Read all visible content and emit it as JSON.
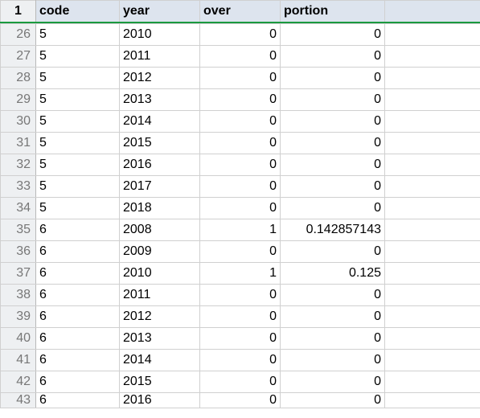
{
  "header_row_number": "1",
  "columns": {
    "code": "code",
    "year": "year",
    "over": "over",
    "portion": "portion",
    "blank": ""
  },
  "rows": [
    {
      "n": "26",
      "code": "5",
      "year": "2010",
      "over": "0",
      "portion": "0"
    },
    {
      "n": "27",
      "code": "5",
      "year": "2011",
      "over": "0",
      "portion": "0"
    },
    {
      "n": "28",
      "code": "5",
      "year": "2012",
      "over": "0",
      "portion": "0"
    },
    {
      "n": "29",
      "code": "5",
      "year": "2013",
      "over": "0",
      "portion": "0"
    },
    {
      "n": "30",
      "code": "5",
      "year": "2014",
      "over": "0",
      "portion": "0"
    },
    {
      "n": "31",
      "code": "5",
      "year": "2015",
      "over": "0",
      "portion": "0"
    },
    {
      "n": "32",
      "code": "5",
      "year": "2016",
      "over": "0",
      "portion": "0"
    },
    {
      "n": "33",
      "code": "5",
      "year": "2017",
      "over": "0",
      "portion": "0"
    },
    {
      "n": "34",
      "code": "5",
      "year": "2018",
      "over": "0",
      "portion": "0"
    },
    {
      "n": "35",
      "code": "6",
      "year": "2008",
      "over": "1",
      "portion": "0.142857143"
    },
    {
      "n": "36",
      "code": "6",
      "year": "2009",
      "over": "0",
      "portion": "0"
    },
    {
      "n": "37",
      "code": "6",
      "year": "2010",
      "over": "1",
      "portion": "0.125"
    },
    {
      "n": "38",
      "code": "6",
      "year": "2011",
      "over": "0",
      "portion": "0"
    },
    {
      "n": "39",
      "code": "6",
      "year": "2012",
      "over": "0",
      "portion": "0"
    },
    {
      "n": "40",
      "code": "6",
      "year": "2013",
      "over": "0",
      "portion": "0"
    },
    {
      "n": "41",
      "code": "6",
      "year": "2014",
      "over": "0",
      "portion": "0"
    },
    {
      "n": "42",
      "code": "6",
      "year": "2015",
      "over": "0",
      "portion": "0"
    },
    {
      "n": "43",
      "code": "6",
      "year": "2016",
      "over": "0",
      "portion": "0"
    }
  ]
}
